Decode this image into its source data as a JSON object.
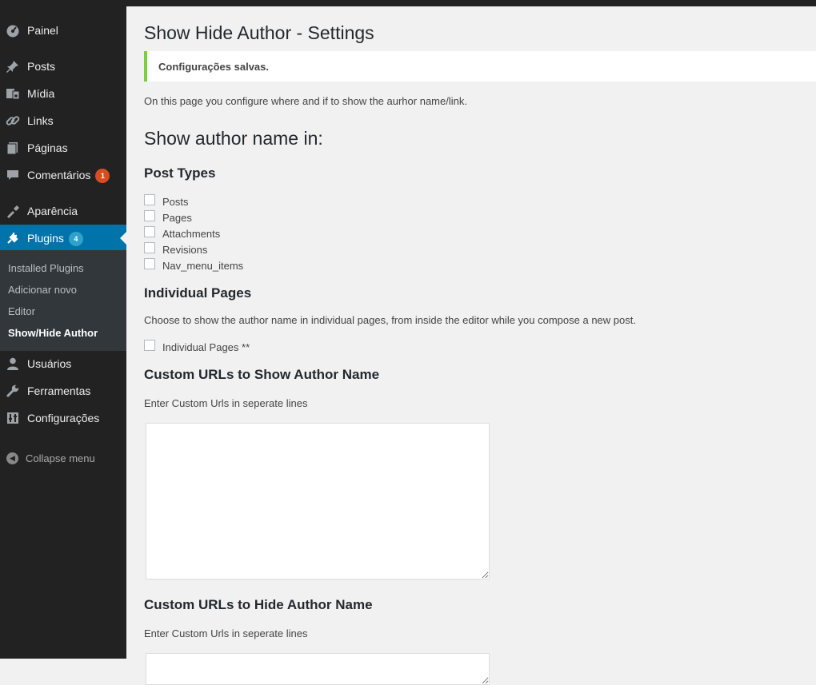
{
  "sidebar": {
    "items": [
      {
        "label": "Painel",
        "icon": "dashboard-icon"
      },
      {
        "label": "Posts",
        "icon": "pin-icon"
      },
      {
        "label": "Mídia",
        "icon": "media-icon"
      },
      {
        "label": "Links",
        "icon": "link-icon"
      },
      {
        "label": "Páginas",
        "icon": "pages-icon"
      },
      {
        "label": "Comentários",
        "icon": "comments-icon",
        "badge": "1"
      },
      {
        "label": "Aparência",
        "icon": "appearance-icon"
      },
      {
        "label": "Plugins",
        "icon": "plugins-icon",
        "badge": "4"
      },
      {
        "label": "Usuários",
        "icon": "users-icon"
      },
      {
        "label": "Ferramentas",
        "icon": "tools-icon"
      },
      {
        "label": "Configurações",
        "icon": "settings-icon"
      }
    ],
    "submenu": [
      "Installed Plugins",
      "Adicionar novo",
      "Editor",
      "Show/Hide Author"
    ],
    "collapse_label": "Collapse menu"
  },
  "page": {
    "title": "Show Hide Author - Settings",
    "notice": "Configurações salvas.",
    "intro": "On this page you configure where and if to show the aurhor name/link.",
    "show_heading": "Show author name in:",
    "post_types_heading": "Post Types",
    "post_types": [
      "Posts",
      "Pages",
      "Attachments",
      "Revisions",
      "Nav_menu_items"
    ],
    "individual_heading": "Individual Pages",
    "individual_desc": "Choose to show the author name in individual pages, from inside the editor while you compose a new post.",
    "individual_checkbox": "Individual Pages **",
    "show_urls_heading": "Custom URLs to Show Author Name",
    "show_urls_desc": "Enter Custom Urls in seperate lines",
    "show_urls_value": "",
    "hide_urls_heading": "Custom URLs to Hide Author Name",
    "hide_urls_desc": "Enter Custom Urls in seperate lines",
    "hide_urls_value": ""
  },
  "colors": {
    "sidebar_bg": "#222222",
    "active": "#0073aa",
    "notice_border": "#7ad03a",
    "badge_red": "#d54e21",
    "badge_blue": "#2ea2cc"
  }
}
